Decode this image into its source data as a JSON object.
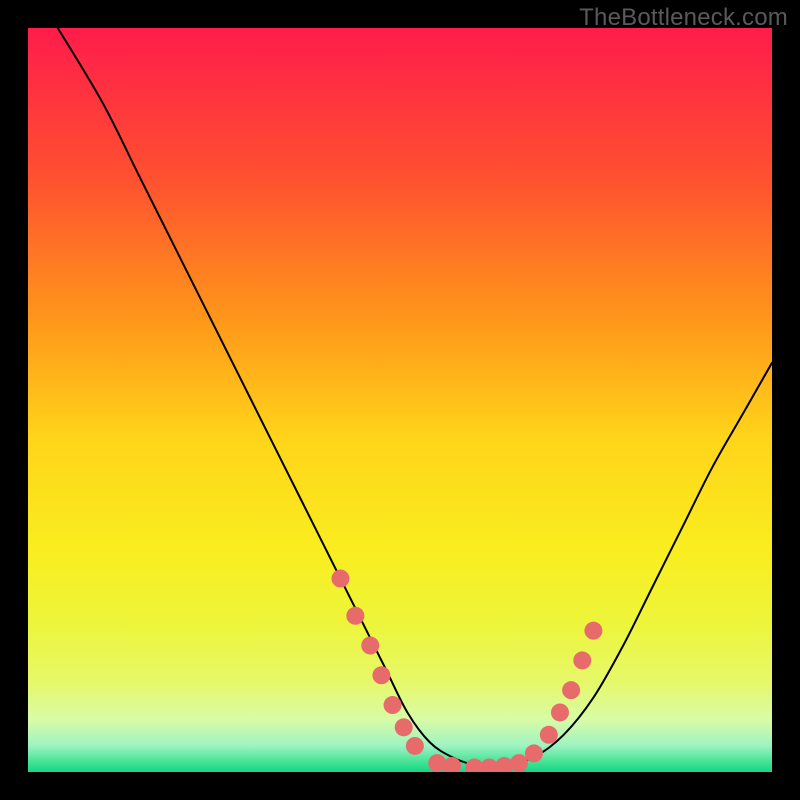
{
  "watermark": "TheBottleneck.com",
  "chart_data": {
    "type": "line",
    "title": "",
    "xlabel": "",
    "ylabel": "",
    "xlim": [
      0,
      100
    ],
    "ylim": [
      0,
      100
    ],
    "grid": false,
    "legend": false,
    "background_gradient": {
      "stops": [
        {
          "pos": 0.0,
          "color": "#ff1c4b"
        },
        {
          "pos": 0.2,
          "color": "#ff5030"
        },
        {
          "pos": 0.4,
          "color": "#ff9a1a"
        },
        {
          "pos": 0.55,
          "color": "#ffd41a"
        },
        {
          "pos": 0.7,
          "color": "#f9ed1f"
        },
        {
          "pos": 0.8,
          "color": "#edf53a"
        },
        {
          "pos": 0.88,
          "color": "#e6f86a"
        },
        {
          "pos": 0.93,
          "color": "#d7fca7"
        },
        {
          "pos": 0.965,
          "color": "#9df3c0"
        },
        {
          "pos": 0.99,
          "color": "#37e08f"
        },
        {
          "pos": 1.0,
          "color": "#14d588"
        }
      ]
    },
    "series": [
      {
        "name": "bottleneck-curve",
        "x": [
          4,
          10,
          15,
          20,
          25,
          30,
          35,
          40,
          44,
          48,
          51,
          54,
          57,
          60,
          64,
          68,
          72,
          76,
          80,
          84,
          88,
          92,
          96,
          100
        ],
        "y": [
          100,
          90,
          80,
          70,
          60,
          50,
          40,
          30,
          22,
          14,
          8,
          4,
          2,
          1,
          1,
          2,
          5,
          10,
          17,
          25,
          33,
          41,
          48,
          55
        ]
      }
    ],
    "markers": {
      "name": "highlight-points",
      "color": "#e86b6b",
      "radius_px": 9,
      "points": [
        {
          "x": 42,
          "y": 26
        },
        {
          "x": 44,
          "y": 21
        },
        {
          "x": 46,
          "y": 17
        },
        {
          "x": 47.5,
          "y": 13
        },
        {
          "x": 49,
          "y": 9
        },
        {
          "x": 50.5,
          "y": 6
        },
        {
          "x": 52,
          "y": 3.5
        },
        {
          "x": 55,
          "y": 1.2
        },
        {
          "x": 57,
          "y": 0.8
        },
        {
          "x": 60,
          "y": 0.6
        },
        {
          "x": 62,
          "y": 0.6
        },
        {
          "x": 64,
          "y": 0.8
        },
        {
          "x": 66,
          "y": 1.2
        },
        {
          "x": 68,
          "y": 2.5
        },
        {
          "x": 70,
          "y": 5
        },
        {
          "x": 71.5,
          "y": 8
        },
        {
          "x": 73,
          "y": 11
        },
        {
          "x": 74.5,
          "y": 15
        },
        {
          "x": 76,
          "y": 19
        }
      ]
    }
  }
}
